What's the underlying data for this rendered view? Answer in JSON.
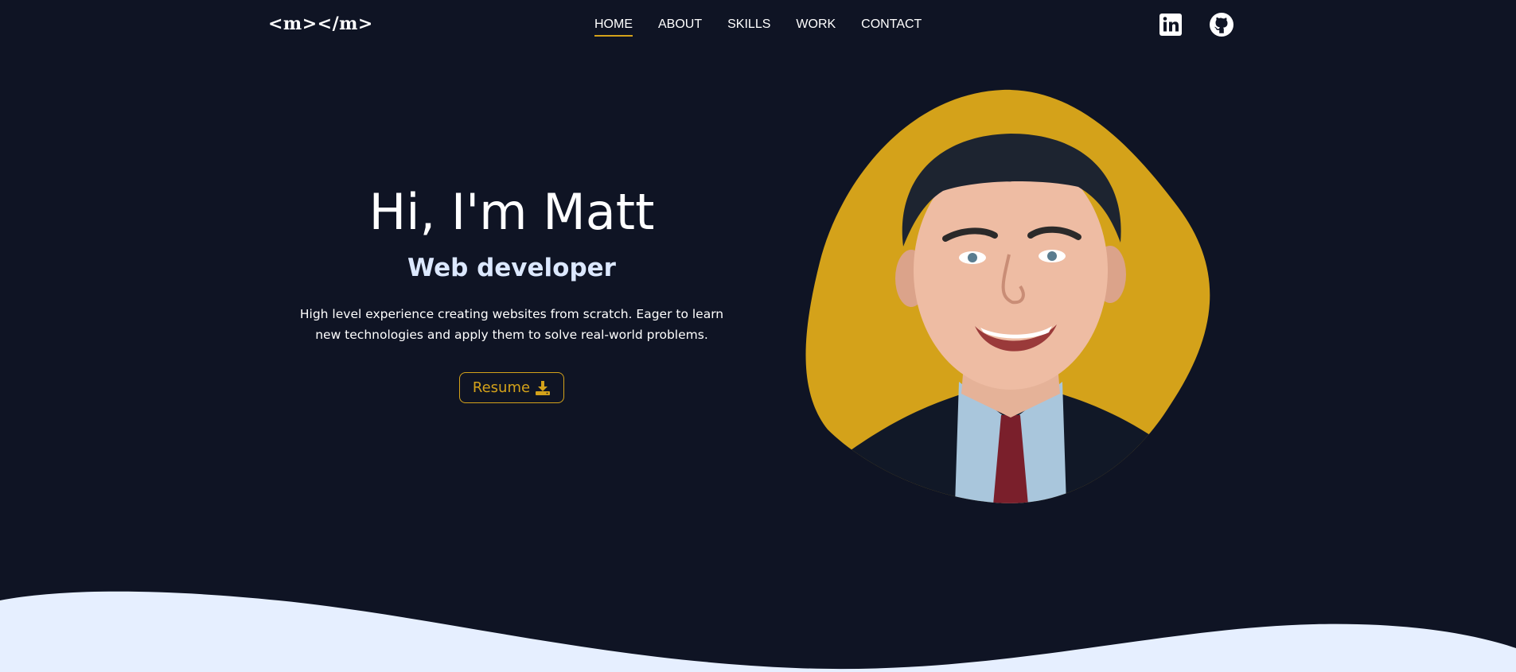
{
  "header": {
    "logo": "<m></m>",
    "nav": [
      {
        "label": "HOME",
        "active": true
      },
      {
        "label": "ABOUT",
        "active": false
      },
      {
        "label": "SKILLS",
        "active": false
      },
      {
        "label": "WORK",
        "active": false
      },
      {
        "label": "CONTACT",
        "active": false
      }
    ],
    "social": [
      {
        "icon": "linkedin-icon"
      },
      {
        "icon": "github-icon"
      }
    ]
  },
  "hero": {
    "title": "Hi, I'm Matt",
    "subtitle": "Web developer",
    "description": "High level experience creating websites from scratch. Eager to learn new technologies and apply them to solve real-world problems.",
    "resume_label": "Resume",
    "resume_icon": "download-icon"
  },
  "colors": {
    "background": "#0f1424",
    "accent": "#d4a21a",
    "wave": "#e6efff",
    "text": "#ffffff"
  }
}
